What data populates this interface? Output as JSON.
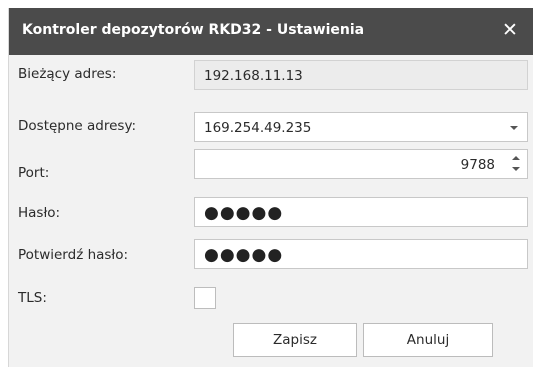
{
  "dialog": {
    "title": "Kontroler depozytorów RKD32 - Ustawienia",
    "close_glyph": "✕"
  },
  "form": {
    "current_address": {
      "label": "Bieżący adres:",
      "value": "192.168.11.13"
    },
    "available_addresses": {
      "label": "Dostępne adresy:",
      "value": "169.254.49.235"
    },
    "port": {
      "label": "Port:",
      "value": "9788"
    },
    "password": {
      "label": "Hasło:",
      "masked_value": "●●●●●"
    },
    "confirm_password": {
      "label": "Potwierdź hasło:",
      "masked_value": "●●●●●"
    },
    "tls": {
      "label": "TLS:",
      "checked": false
    }
  },
  "buttons": {
    "save": "Zapisz",
    "cancel": "Anuluj"
  },
  "icons": {
    "close": "close-icon",
    "dropdown": "chevron-down-icon",
    "spin": "spin-updown-icon"
  },
  "colors": {
    "titlebar": "#4b4b4b",
    "dialog_bg": "#f2f2f2",
    "readonly_field": "#ececec"
  }
}
